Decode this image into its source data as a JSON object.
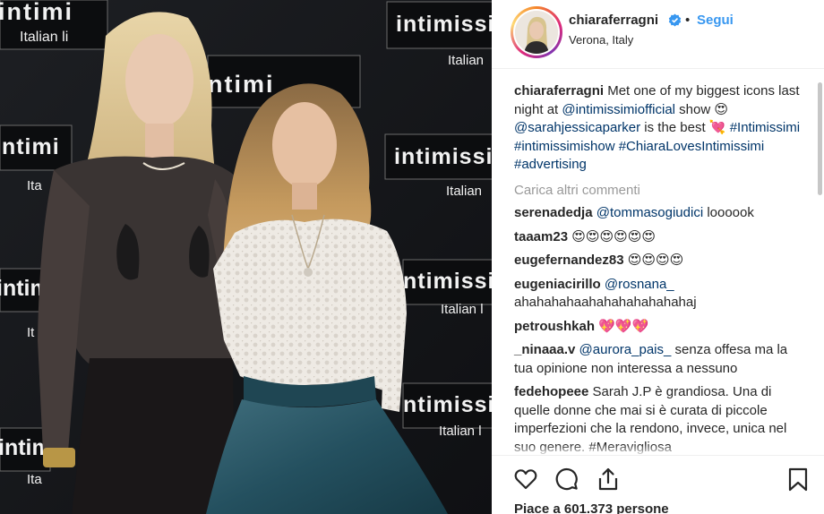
{
  "post": {
    "username": "chiaraferragni",
    "follow_label": "Segui",
    "location": "Verona, Italy",
    "dot": "•"
  },
  "photo": {
    "backdrop_brand": "intimissi",
    "backdrop_brand_alt": "intimiss",
    "backdrop_brand_short": "intimi",
    "backdrop_brand_mid": "ntimissi",
    "backdrop_brand_end": "ntimi",
    "backdrop_tagline": "Italian lingerie",
    "tagline_short": "Italian li",
    "tagline_shorter": "Italian l",
    "tagline_italian": "Italian",
    "ita": "Ita",
    "it": "It"
  },
  "caption": {
    "username": "chiaraferragni",
    "text_1": " Met one of my biggest icons last night at ",
    "mention_1": "@intimissimiofficial",
    "text_2": " show 😍 ",
    "mention_2": "@sarahjessicaparker",
    "text_3": " is the best 💘 ",
    "hashtag_1": "#Intimissimi",
    "hashtag_2": "#intimissimishow",
    "hashtag_3": "#ChiaraLovesIntimissimi",
    "hashtag_4": "#advertising"
  },
  "load_more": "Carica altri commenti",
  "comments": [
    {
      "username": "serenadedja",
      "mention": "@tommasogiudici",
      "text": " loooook"
    },
    {
      "username": "taaam23",
      "mention": "",
      "text": " 😍😍😍😍😍😍"
    },
    {
      "username": "eugefernandez83",
      "mention": "",
      "text": " 😍😍😍😍"
    },
    {
      "username": "eugeniacirillo",
      "mention": "@rosnana_",
      "text": " ahahahahaahahahahahahahaj"
    },
    {
      "username": "petroushkah",
      "mention": "",
      "text": " 💖💖💖"
    },
    {
      "username": "_ninaaa.v",
      "mention": "@aurora_pais_",
      "text": " senza offesa ma la tua opinione non interessa a nessuno"
    },
    {
      "username": "fedehopeee",
      "mention": "",
      "text": " Sarah J.P è grandiosa. Una di quelle donne che mai si è curata di piccole imperfezioni che la rendono, invece, unica nel suo genere. #Meravigliosa"
    }
  ],
  "likes_label": "Piace a 601.373 persone",
  "icons": {
    "verified": "verified-badge-icon",
    "like": "heart-icon",
    "comment": "comment-bubble-icon",
    "share": "share-icon",
    "save": "bookmark-icon"
  },
  "colors": {
    "follow_blue": "#3897f0",
    "link_blue": "#003569",
    "muted": "#999999",
    "photo_bg": "#15171a"
  }
}
